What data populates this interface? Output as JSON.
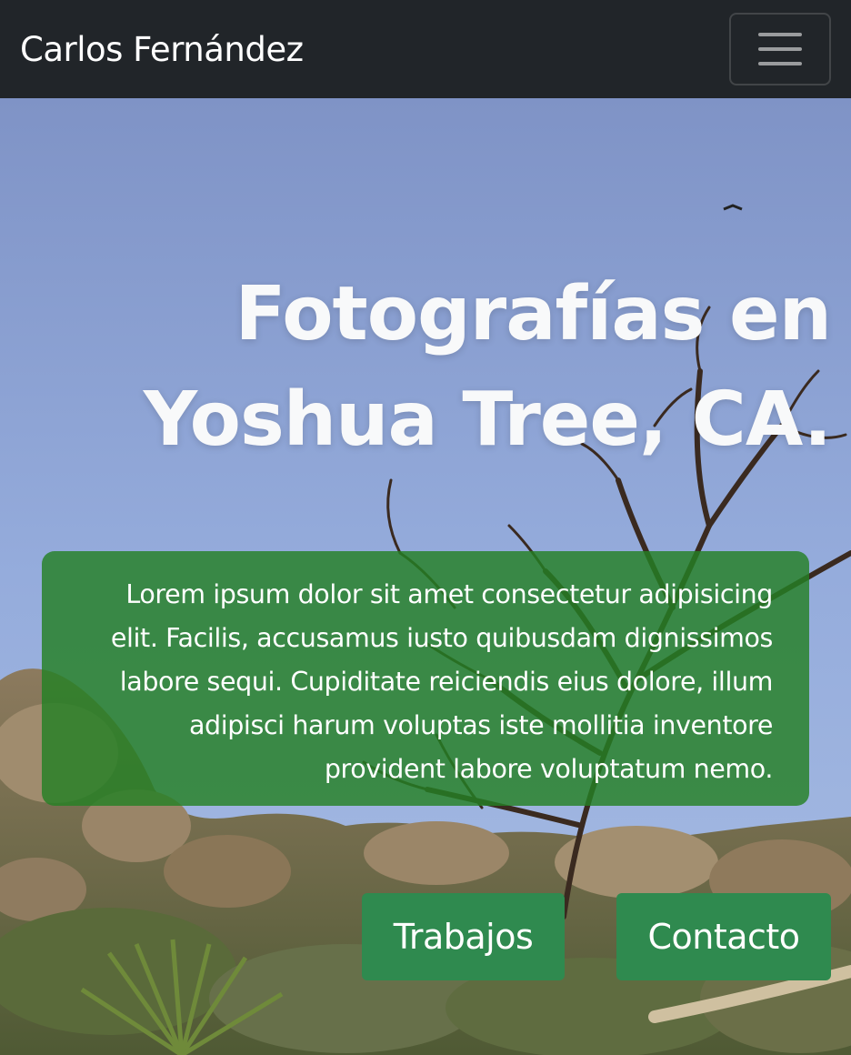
{
  "navbar": {
    "brand": "Carlos Fernández",
    "toggler_icon": "hamburger-menu-icon"
  },
  "hero": {
    "title_line1": "Fotografías en",
    "title_line2": "Yoshua Tree, CA.",
    "description": "Lorem ipsum dolor sit amet consectetur adipisicing elit. Facilis, accusamus iusto quibusdam dignissimos labore sequi. Cupiditate reiciendis eius dolore, illum adipisci harum voluptas iste mollitia inventore provident labore voluptatum nemo.",
    "buttons": {
      "trabajos": "Trabajos",
      "contacto": "Contacto"
    }
  },
  "colors": {
    "navbar_bg": "#212529",
    "desc_box_bg": "#248024",
    "button_bg": "#2f8a4f",
    "sky": "#8da5d6"
  }
}
